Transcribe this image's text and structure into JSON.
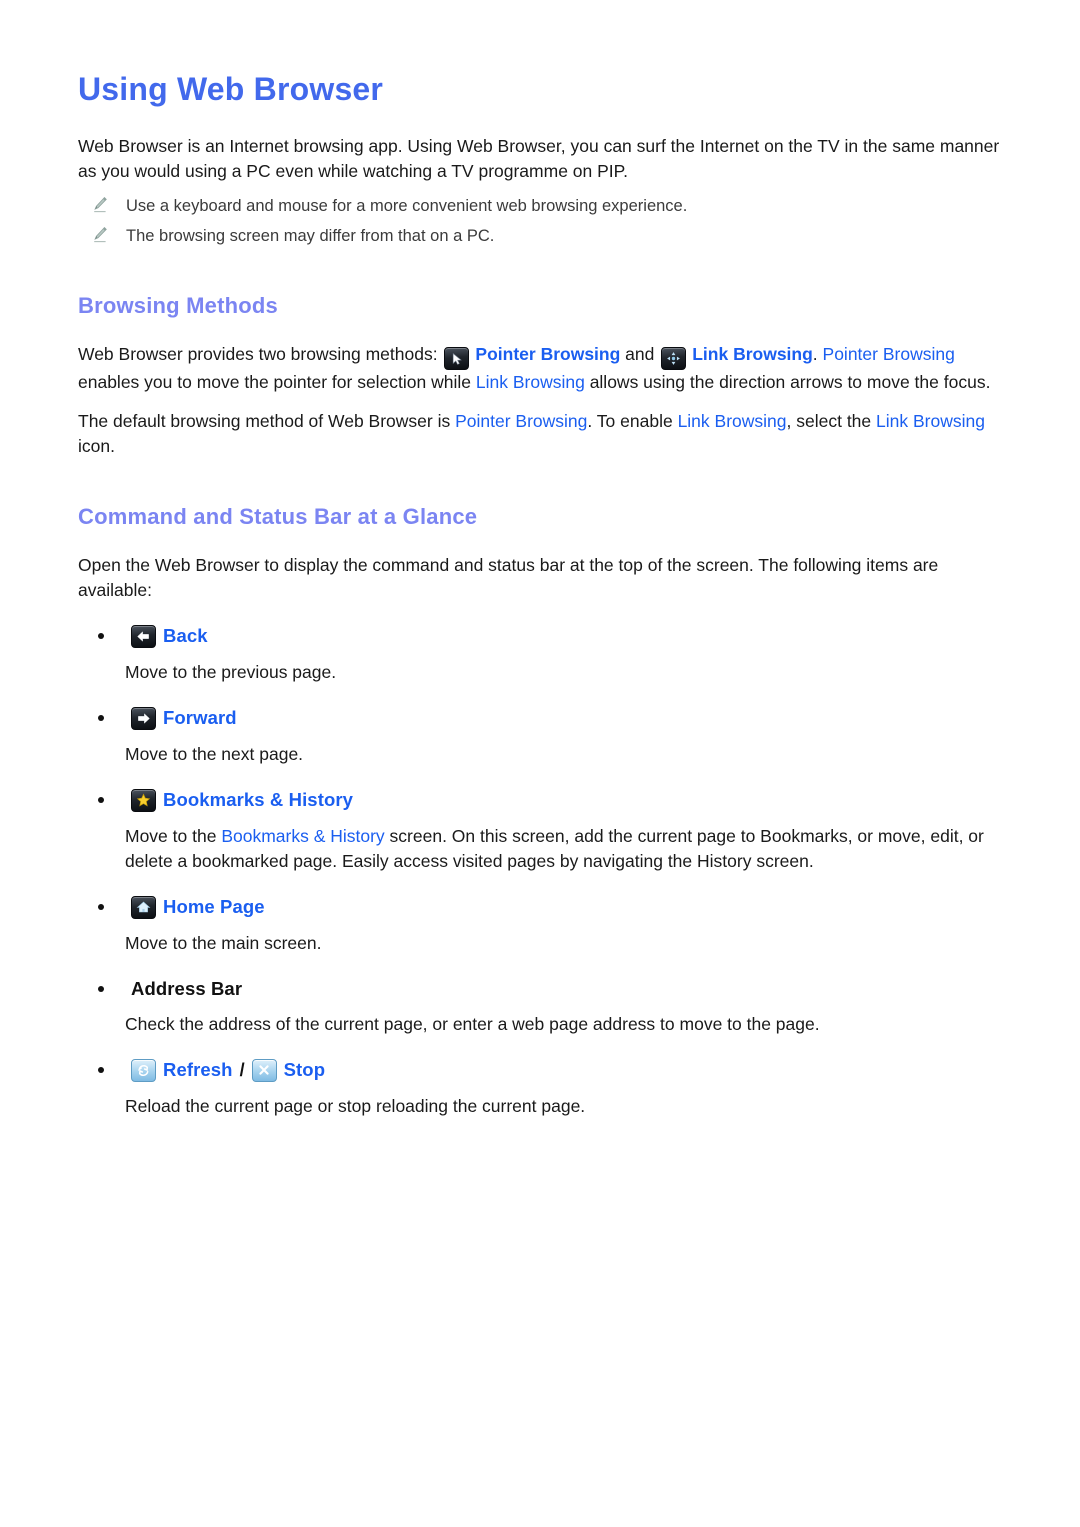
{
  "document": {
    "title": "Using Web Browser",
    "intro": {
      "line1": "Web Browser is an Internet browsing app. Using Web Browser, you can surf the Internet on the TV in",
      "line2": "the same manner as you would using a PC even while watching a TV programme on PIP."
    },
    "notes": [
      {
        "icon": "pencil-icon",
        "text": "Use a keyboard and mouse for a more convenient web browsing experience."
      },
      {
        "icon": "pencil-icon",
        "text": "The browsing screen may differ from that on a PC."
      }
    ]
  },
  "browsing_methods": {
    "heading": "Browsing Methods",
    "paragraph1": {
      "seg1": "Web Browser provides two browsing methods: ",
      "icon1": "pointer-browsing-icon",
      "link1": "Pointer Browsing",
      "seg2": " and ",
      "icon2": "link-browsing-icon",
      "link2": "Link Browsing",
      "seg3": ". ",
      "link3": "Pointer Browsing",
      "seg4": " enables you to move the pointer for selection while ",
      "link4": "Link Browsing",
      "seg5": " allows using the direction arrows to move the focus."
    },
    "paragraph2": {
      "seg1": "The default browsing method of Web Browser is ",
      "link1": "Pointer Browsing",
      "seg2": ". To enable ",
      "link2": "Link Browsing",
      "seg3": ", select the ",
      "link3": "Link Browsing",
      "seg4": " icon."
    }
  },
  "command_status_bar": {
    "heading": "Command and Status Bar at a Glance",
    "intro": "Open the Web Browser to display the command and status bar at the top of the screen. The following items are available:",
    "items": [
      {
        "icon": "back-arrow-icon",
        "icon_style": "dark",
        "label": "Back",
        "label_style": "link",
        "description": "Move to the previous page."
      },
      {
        "icon": "forward-arrow-icon",
        "icon_style": "dark",
        "label": "Forward",
        "label_style": "link",
        "description": "Move to the next page."
      },
      {
        "icon": "star-bookmark-icon",
        "icon_style": "dark",
        "label": "Bookmarks & History",
        "label_style": "link",
        "description_seg1": "Move to the ",
        "description_link": "Bookmarks & History",
        "description_seg2": " screen. On this screen, add the current page to Bookmarks, or move, edit, or delete a bookmarked page. Easily access visited pages by navigating the History screen."
      },
      {
        "icon": "home-icon",
        "icon_style": "dark",
        "label": "Home Page",
        "label_style": "link",
        "description": "Move to the main screen."
      },
      {
        "icon": "none",
        "icon_style": "none",
        "label": "Address Bar",
        "label_style": "plain",
        "description": "Check the address of the current page, or enter a web page address to move to the page."
      },
      {
        "icon": "refresh-icon",
        "icon_style": "light",
        "label": "Refresh",
        "label_style": "link",
        "separator": "/",
        "icon2": "stop-x-icon",
        "icon2_style": "light",
        "label2": "Stop",
        "description": "Reload the current page or stop reloading the current page."
      }
    ]
  },
  "colors": {
    "title_blue": "#4269ec",
    "heading_blue": "#7b85f2",
    "link_blue": "#1a5ef0",
    "body_text": "#1a1a1a",
    "note_text": "#3b3b3b",
    "pencil_grey": "#9fb0ac",
    "star_gold": "#f5c518",
    "chip_dark": "#141a20",
    "chip_light": "#a9d4ef",
    "background": "#ffffff"
  }
}
